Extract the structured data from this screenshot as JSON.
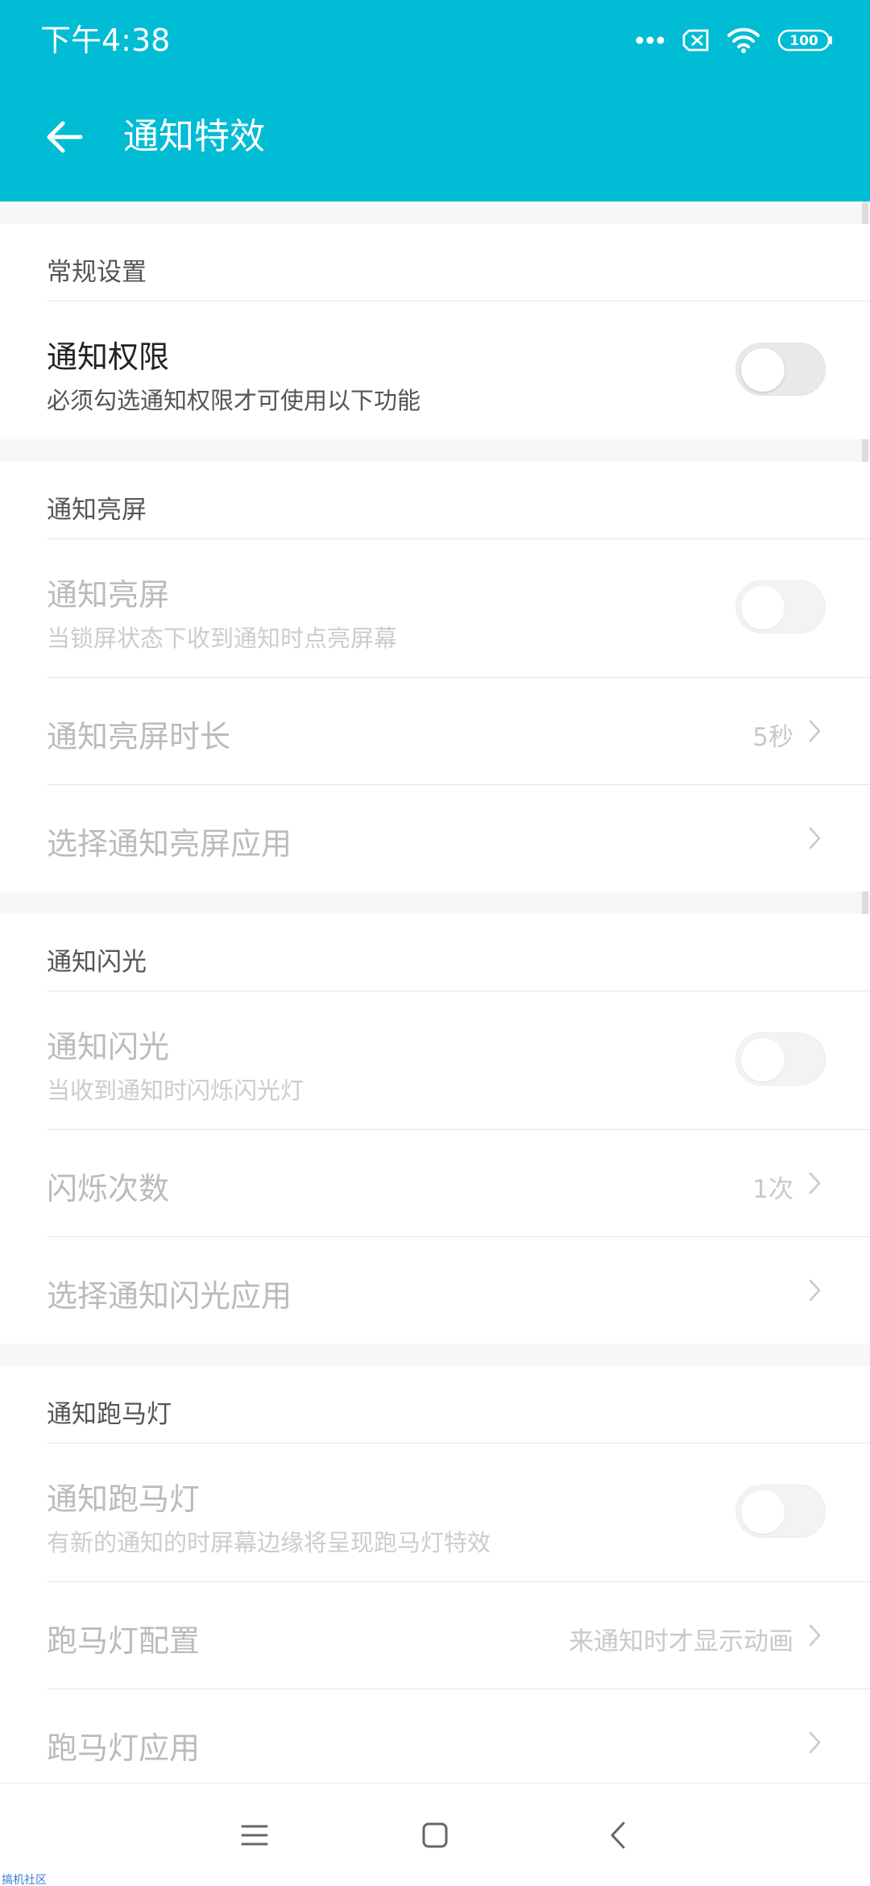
{
  "status_bar": {
    "time": "下午4:38",
    "battery": "100",
    "icons": [
      "more-dots-icon",
      "sim-missing-icon",
      "wifi-icon",
      "battery-icon"
    ]
  },
  "header": {
    "title": "通知特效",
    "background_color": "#00bcd4"
  },
  "sections": {
    "general": {
      "title": "常规设置",
      "permission": {
        "title": "通知权限",
        "subtitle": "必须勾选通知权限才可使用以下功能",
        "enabled": false
      }
    },
    "screen": {
      "title": "通知亮屏",
      "wake": {
        "title": "通知亮屏",
        "subtitle": "当锁屏状态下收到通知时点亮屏幕",
        "enabled": false
      },
      "duration": {
        "title": "通知亮屏时长",
        "value": "5秒"
      },
      "apps": {
        "title": "选择通知亮屏应用"
      }
    },
    "flash": {
      "title": "通知闪光",
      "flash": {
        "title": "通知闪光",
        "subtitle": "当收到通知时闪烁闪光灯",
        "enabled": false
      },
      "count": {
        "title": "闪烁次数",
        "value": "1次"
      },
      "apps": {
        "title": "选择通知闪光应用"
      }
    },
    "marquee": {
      "title": "通知跑马灯",
      "marquee": {
        "title": "通知跑马灯",
        "subtitle": "有新的通知的时屏幕边缘将呈现跑马灯特效",
        "enabled": false
      },
      "config": {
        "title": "跑马灯配置",
        "value": "来通知时才显示动画"
      },
      "apps": {
        "title": "跑马灯应用"
      }
    }
  },
  "navbar": {
    "icons": [
      "menu-icon",
      "home-icon",
      "back-icon"
    ]
  },
  "watermark": "搞机社区"
}
